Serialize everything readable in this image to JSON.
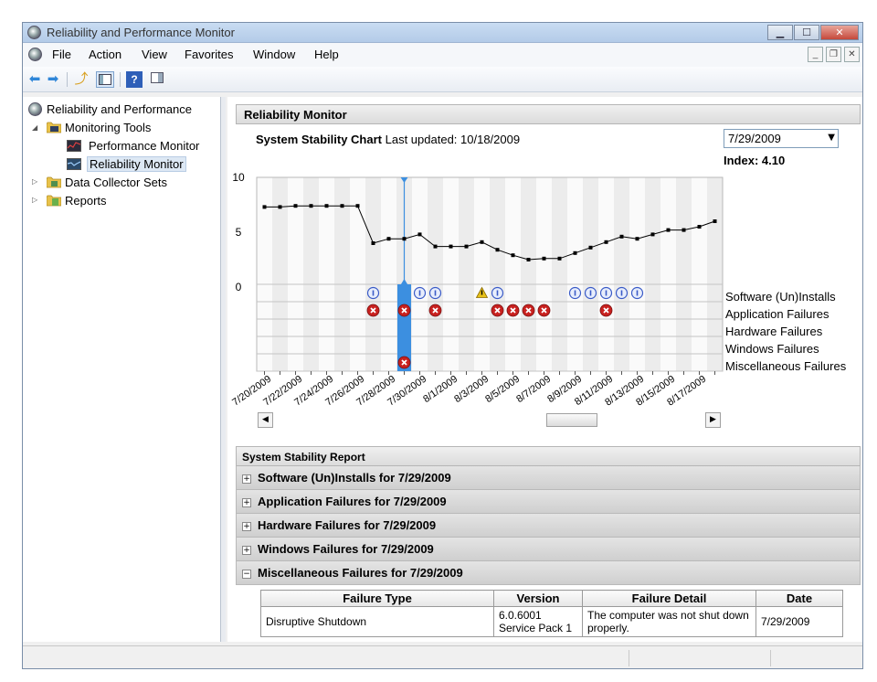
{
  "window": {
    "title": "Reliability and Performance Monitor"
  },
  "menu": {
    "items": [
      "File",
      "Action",
      "View",
      "Favorites",
      "Window",
      "Help"
    ]
  },
  "tree": {
    "root": "Reliability and Performance",
    "monitoring_tools": "Monitoring Tools",
    "performance_monitor": "Performance Monitor",
    "reliability_monitor": "Reliability Monitor",
    "data_collector_sets": "Data Collector Sets",
    "reports": "Reports"
  },
  "reliability": {
    "header": "Reliability Monitor",
    "chart_title": "System Stability Chart",
    "last_updated": "Last updated: 10/18/2009",
    "selected_date": "7/29/2009",
    "index": "Index: 4.10"
  },
  "chart_data": {
    "type": "line",
    "ylim": [
      0,
      10
    ],
    "yticks": [
      "10",
      "5",
      "0"
    ],
    "x": [
      "7/20/2009",
      "7/21/2009",
      "7/22/2009",
      "7/23/2009",
      "7/24/2009",
      "7/25/2009",
      "7/26/2009",
      "7/27/2009",
      "7/28/2009",
      "7/29/2009",
      "7/30/2009",
      "7/31/2009",
      "8/1/2009",
      "8/2/2009",
      "8/3/2009",
      "8/4/2009",
      "8/5/2009",
      "8/6/2009",
      "8/7/2009",
      "8/8/2009",
      "8/9/2009",
      "8/10/2009",
      "8/11/2009",
      "8/12/2009",
      "8/13/2009",
      "8/14/2009",
      "8/15/2009",
      "8/16/2009",
      "8/17/2009",
      "8/18/2009"
    ],
    "values": [
      7.3,
      7.3,
      7.4,
      7.4,
      7.4,
      7.4,
      7.4,
      4.0,
      4.4,
      4.4,
      4.8,
      3.7,
      3.7,
      3.7,
      4.1,
      3.4,
      2.9,
      2.5,
      2.6,
      2.6,
      3.1,
      3.6,
      4.1,
      4.6,
      4.4,
      4.8,
      5.2,
      5.2,
      5.5,
      6.0
    ],
    "tick_labels": [
      "7/20/2009",
      "7/22/2009",
      "7/24/2009",
      "7/26/2009",
      "7/28/2009",
      "7/30/2009",
      "8/1/2009",
      "8/3/2009",
      "8/5/2009",
      "8/7/2009",
      "8/9/2009",
      "8/11/2009",
      "8/13/2009",
      "8/15/2009",
      "8/17/2009"
    ],
    "selected_index": 9,
    "categories": [
      "Software (Un)Installs",
      "Application Failures",
      "Hardware Failures",
      "Windows Failures",
      "Miscellaneous Failures"
    ],
    "events": {
      "software": [
        7,
        10,
        11,
        15,
        20,
        21,
        22,
        23,
        24
      ],
      "software_warning": [
        14
      ],
      "application": [
        7,
        9,
        11,
        15,
        16,
        17,
        18,
        22
      ],
      "misc": [
        9
      ]
    },
    "colors": {
      "line": "#000000",
      "selected": "#3c8fe0",
      "error": "#c8211f",
      "info": "#3a5bc7",
      "warning": "#e8c21a"
    }
  },
  "report": {
    "header": "System Stability Report",
    "sections": [
      "Software (Un)Installs for 7/29/2009",
      "Application Failures for 7/29/2009",
      "Hardware Failures for 7/29/2009",
      "Windows Failures for 7/29/2009",
      "Miscellaneous Failures for 7/29/2009"
    ],
    "table": {
      "headers": [
        "Failure Type",
        "Version",
        "Failure Detail",
        "Date"
      ],
      "row": {
        "type": "Disruptive Shutdown",
        "version_1": "6.0.6001",
        "version_2": "Service Pack 1",
        "detail": "The computer was not shut down properly.",
        "date": "7/29/2009"
      }
    }
  }
}
